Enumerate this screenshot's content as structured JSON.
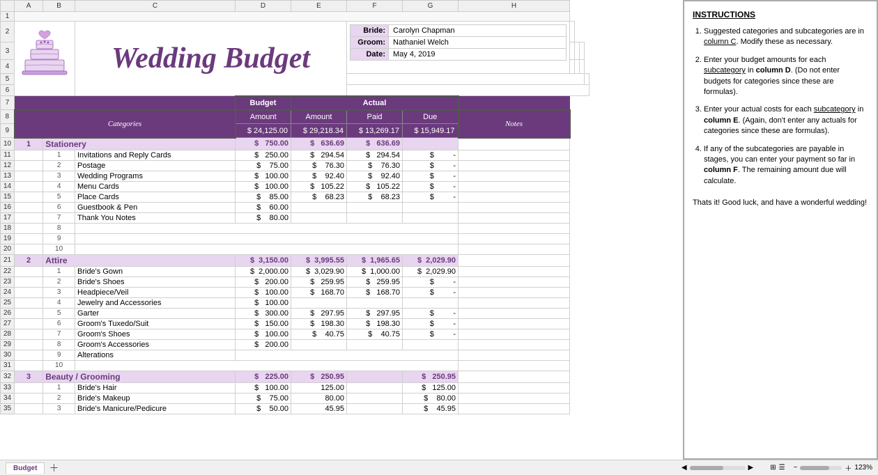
{
  "title": "Wedding Budget",
  "bride_label": "Bride:",
  "bride_value": "Carolyn Chapman",
  "groom_label": "Groom:",
  "groom_value": "Nathaniel Welch",
  "date_label": "Date:",
  "date_value": "May 4, 2019",
  "headers": {
    "categories": "Categories",
    "notes": "Notes",
    "budget": "Budget",
    "actual": "Actual",
    "amount": "Amount",
    "paid": "Paid",
    "due": "Due"
  },
  "totals": {
    "budget_amount": "$ 24,125.00",
    "actual_amount": "$ 29,218.34",
    "paid": "$ 13,269.17",
    "due": "$ 15,949.17"
  },
  "instructions": {
    "title": "INSTRUCTIONS",
    "items": [
      "Suggested categories and subcategories are in column C.  Modify these as necessary.",
      "Enter your budget amounts for each subcategory in column D.  (Do not enter budgets for categories since these are formulas).",
      "Enter your actual costs for each subcategory in column E.  (Again, don't enter any actuals for categories since these are formulas).",
      "If any of the subcategories are payable in stages, you can enter your payment so far in column F.  The remaining amount due will calculate."
    ],
    "footer": "Thats it!  Good luck, and have a wonderful wedding!"
  },
  "rows": [
    {
      "type": "category",
      "num": "1",
      "name": "Stationery",
      "budget": "$ 750.00",
      "actual": "$ 636.69",
      "paid": "$ 636.69",
      "due": ""
    },
    {
      "type": "sub",
      "num": "1",
      "name": "Invitations and Reply Cards",
      "budget": "$ 250.00",
      "actual": "$ 294.54",
      "paid": "$ 294.54",
      "due": "$        -"
    },
    {
      "type": "sub",
      "num": "2",
      "name": "Postage",
      "budget": "$ 75.00",
      "actual": "$ 76.30",
      "paid": "$ 76.30",
      "due": "$        -"
    },
    {
      "type": "sub",
      "num": "3",
      "name": "Wedding Programs",
      "budget": "$ 100.00",
      "actual": "$ 92.40",
      "paid": "$ 92.40",
      "due": "$        -"
    },
    {
      "type": "sub",
      "num": "4",
      "name": "Menu Cards",
      "budget": "$ 100.00",
      "actual": "$ 105.22",
      "paid": "$ 105.22",
      "due": "$        -"
    },
    {
      "type": "sub",
      "num": "5",
      "name": "Place Cards",
      "budget": "$ 85.00",
      "actual": "$ 68.23",
      "paid": "$ 68.23",
      "due": "$        -"
    },
    {
      "type": "sub",
      "num": "6",
      "name": "Guestbook & Pen",
      "budget": "$ 60.00",
      "actual": "",
      "paid": "",
      "due": ""
    },
    {
      "type": "sub",
      "num": "7",
      "name": "Thank You Notes",
      "budget": "$ 80.00",
      "actual": "",
      "paid": "",
      "due": ""
    },
    {
      "type": "empty",
      "num": "8",
      "name": "",
      "budget": "",
      "actual": "",
      "paid": "",
      "due": ""
    },
    {
      "type": "empty",
      "num": "9",
      "name": "",
      "budget": "",
      "actual": "",
      "paid": "",
      "due": ""
    },
    {
      "type": "empty",
      "num": "10",
      "name": "",
      "budget": "",
      "actual": "",
      "paid": "",
      "due": ""
    },
    {
      "type": "category",
      "num": "2",
      "name": "Attire",
      "budget": "$ 3,150.00",
      "actual": "$ 3,995.55",
      "paid": "$ 1,965.65",
      "due": "$ 2,029.90"
    },
    {
      "type": "sub",
      "num": "1",
      "name": "Bride's Gown",
      "budget": "$ 2,000.00",
      "actual": "$ 3,029.90",
      "paid": "$ 1,000.00",
      "due": "$ 2,029.90"
    },
    {
      "type": "sub",
      "num": "2",
      "name": "Bride's Shoes",
      "budget": "$ 200.00",
      "actual": "$ 259.95",
      "paid": "$ 259.95",
      "due": "$        -"
    },
    {
      "type": "sub",
      "num": "3",
      "name": "Headpiece/Veil",
      "budget": "$ 100.00",
      "actual": "$ 168.70",
      "paid": "$ 168.70",
      "due": "$        -"
    },
    {
      "type": "sub",
      "num": "4",
      "name": "Jewelry and Accessories",
      "budget": "$ 100.00",
      "actual": "",
      "paid": "",
      "due": ""
    },
    {
      "type": "sub",
      "num": "5",
      "name": "Garter",
      "budget": "$ 300.00",
      "actual": "$ 297.95",
      "paid": "$ 297.95",
      "due": "$        -"
    },
    {
      "type": "sub",
      "num": "6",
      "name": "Groom's Tuxedo/Suit",
      "budget": "$ 150.00",
      "actual": "$ 198.30",
      "paid": "$ 198.30",
      "due": "$        -"
    },
    {
      "type": "sub",
      "num": "7",
      "name": "Groom's Shoes",
      "budget": "$ 100.00",
      "actual": "$ 40.75",
      "paid": "$ 40.75",
      "due": "$        -"
    },
    {
      "type": "sub",
      "num": "8",
      "name": "Groom's Accessories",
      "budget": "$ 200.00",
      "actual": "",
      "paid": "",
      "due": ""
    },
    {
      "type": "sub",
      "num": "9",
      "name": "Alterations",
      "budget": "",
      "actual": "",
      "paid": "",
      "due": ""
    },
    {
      "type": "empty",
      "num": "10",
      "name": "",
      "budget": "",
      "actual": "",
      "paid": "",
      "due": ""
    },
    {
      "type": "category",
      "num": "3",
      "name": "Beauty / Grooming",
      "budget": "$ 225.00",
      "actual": "$ 250.95",
      "paid": "",
      "due": "$ 250.95"
    },
    {
      "type": "sub",
      "num": "1",
      "name": "Bride's Hair",
      "budget": "$ 100.00",
      "actual": "125.00",
      "paid": "",
      "due": "$ 125.00"
    },
    {
      "type": "sub",
      "num": "2",
      "name": "Bride's Makeup",
      "budget": "$ 75.00",
      "actual": "80.00",
      "paid": "",
      "due": "$ 80.00"
    },
    {
      "type": "sub",
      "num": "3",
      "name": "Bride's Manicure/Pedicure",
      "budget": "$ 50.00",
      "actual": "45.95",
      "paid": "",
      "due": "$ 45.95"
    }
  ],
  "col_widths": {
    "row_num": "20",
    "A": "18",
    "B": "20",
    "C": "230",
    "D": "80",
    "E": "80",
    "F": "80",
    "G": "80",
    "H": "160",
    "I": "10",
    "J": "10",
    "instructions": "280"
  },
  "bottom_tab": "Budget",
  "zoom": "123%"
}
